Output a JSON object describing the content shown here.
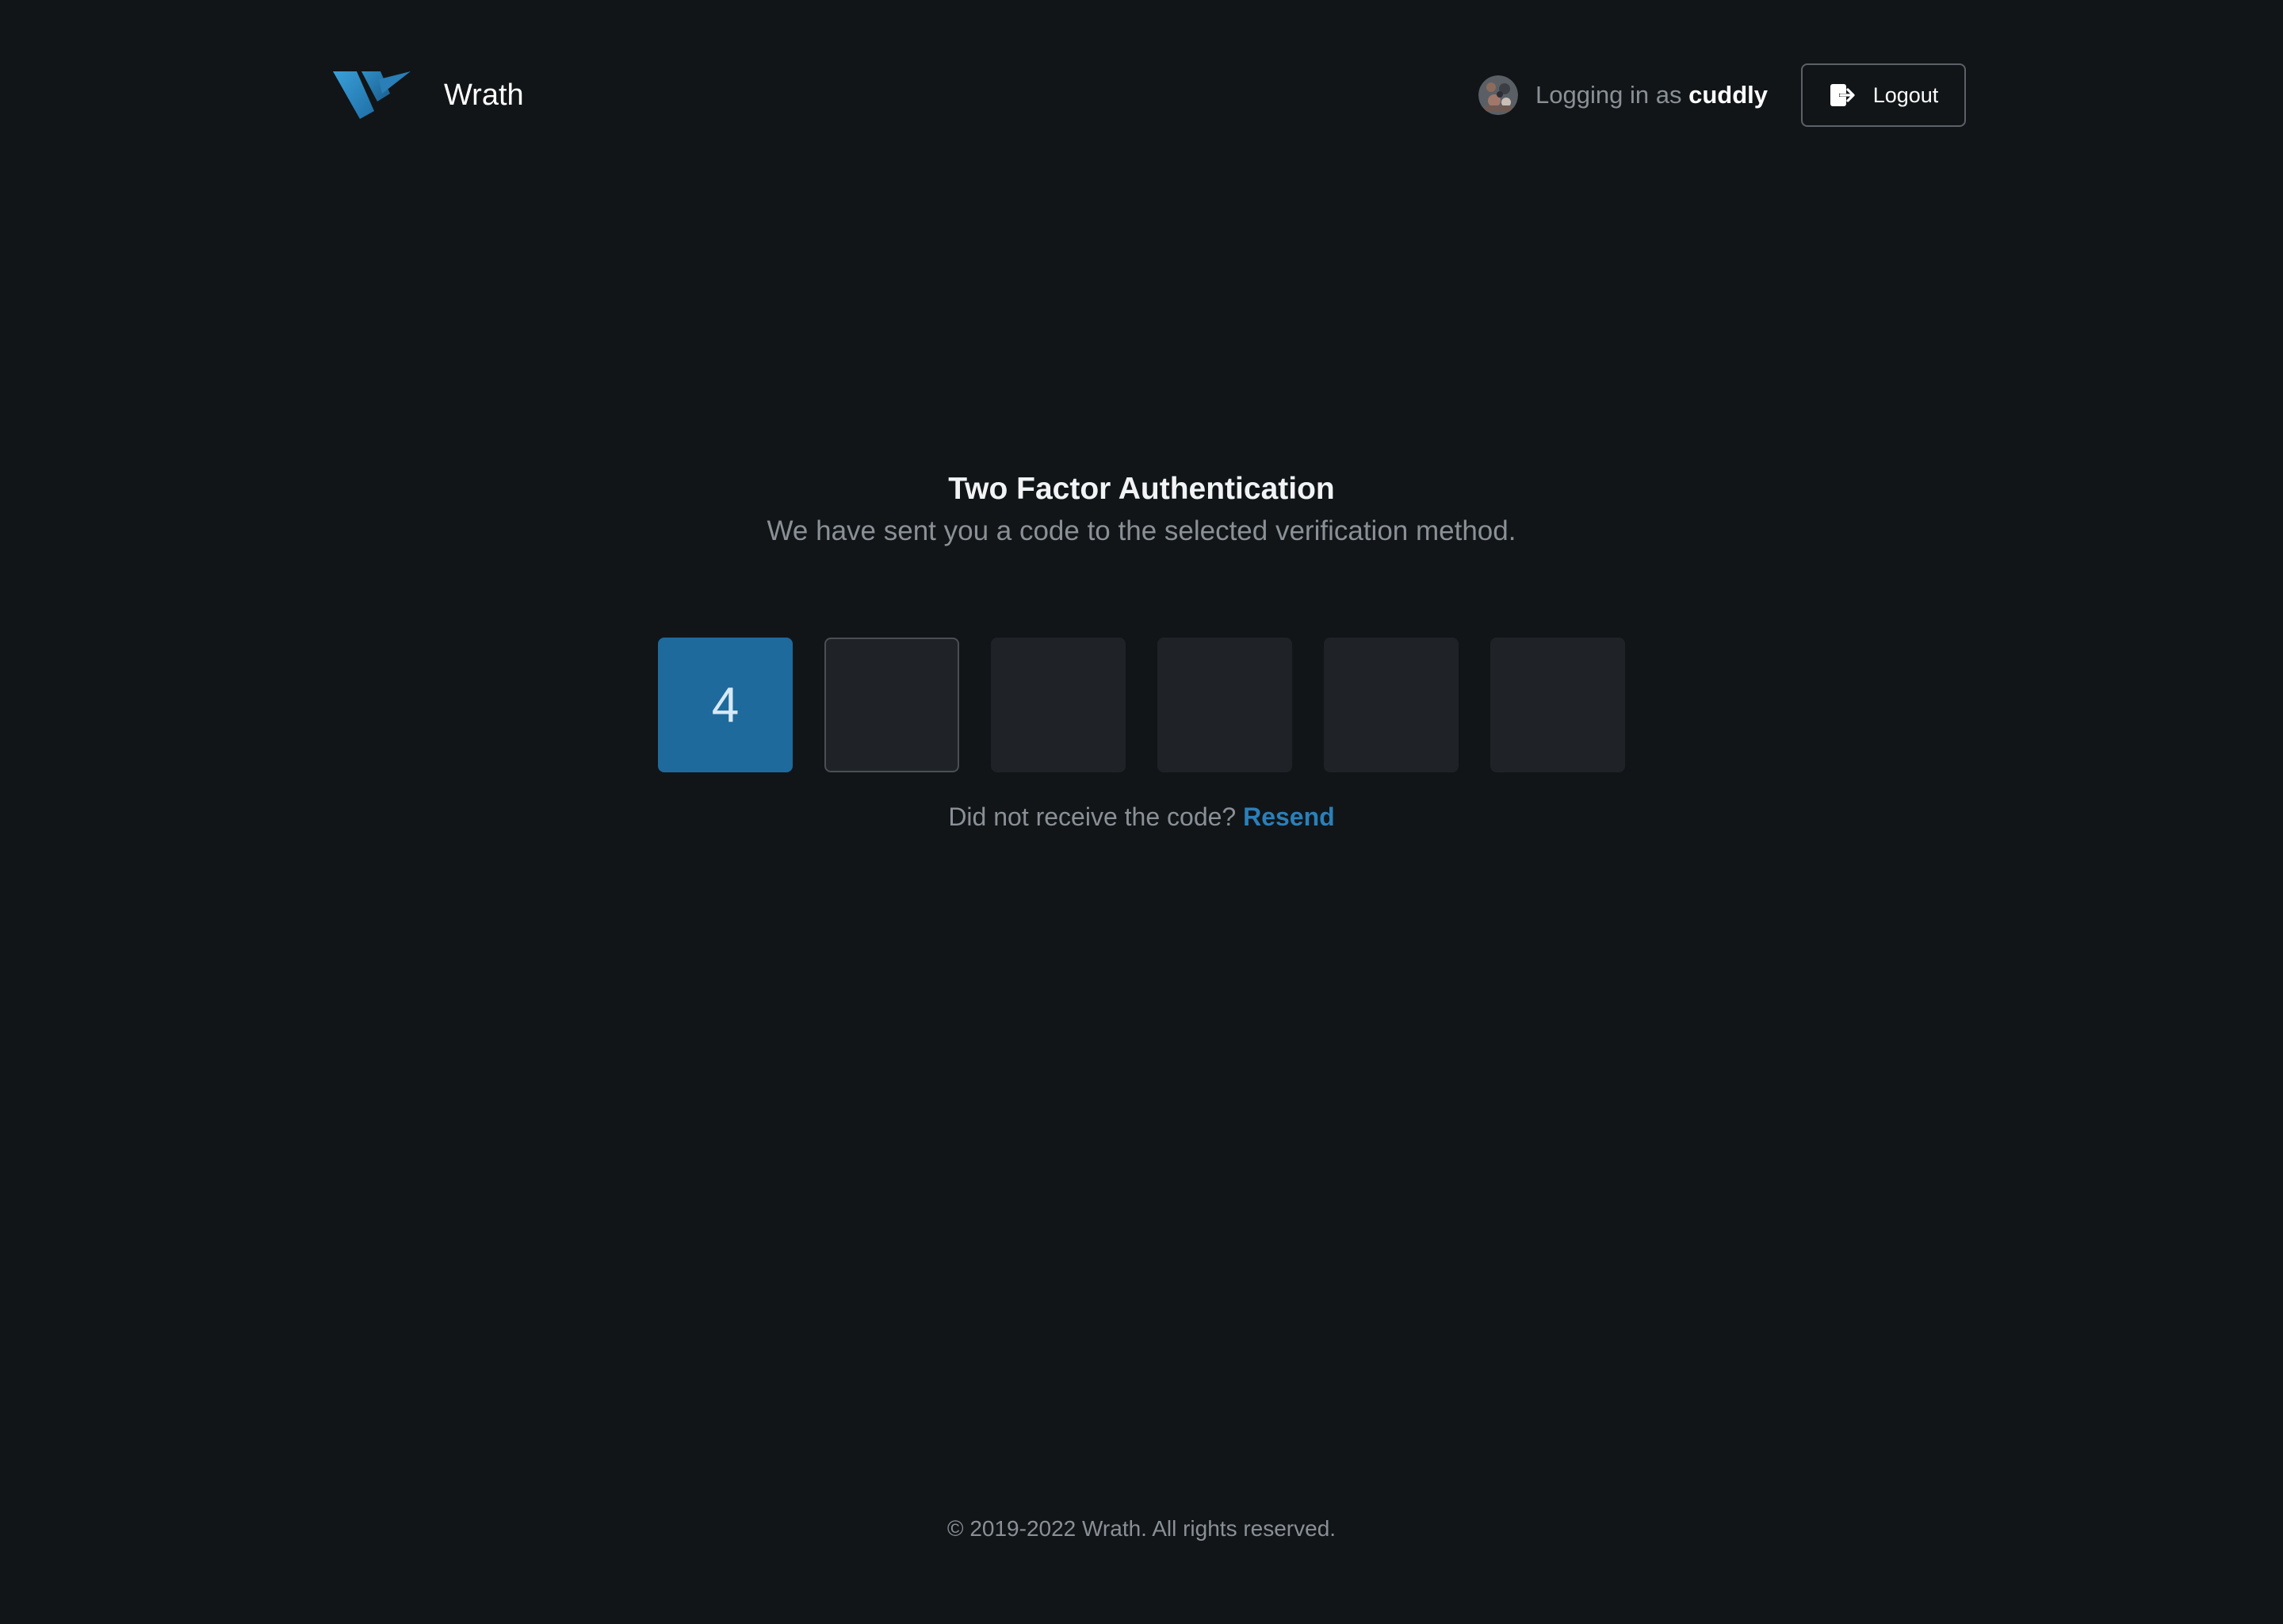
{
  "app": {
    "brand_name": "Wrath",
    "logo_icon": "wrath-logo-icon"
  },
  "header": {
    "avatar_icon": "user-avatar",
    "login_prefix": "Logging in as",
    "username": "cuddly",
    "logout_label": "Logout",
    "logout_icon": "logout-icon"
  },
  "auth": {
    "title": "Two Factor Authentication",
    "subtitle": "We have sent you a code to the selected verification method.",
    "code_digits": [
      "4",
      "",
      "",
      "",
      "",
      ""
    ],
    "resend_prompt": "Did not receive the code?",
    "resend_label": "Resend"
  },
  "footer": {
    "copyright": "© 2019-2022 Wrath. All rights reserved."
  },
  "colors": {
    "background": "#111518",
    "accent": "#1e6a9c",
    "link": "#2b7fb8",
    "input_bg": "#1f2327",
    "muted_text": "#8a9096"
  }
}
